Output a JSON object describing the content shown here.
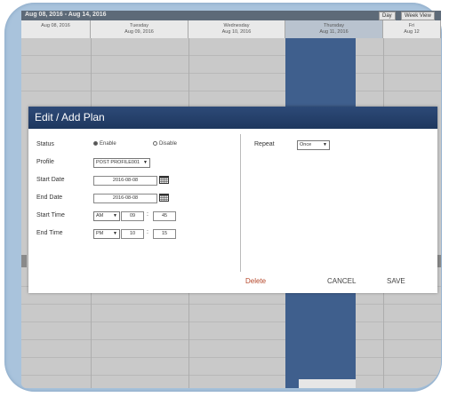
{
  "calendar": {
    "range": "Aug 08, 2016 - Aug 14, 2016",
    "buttons": [
      "Day",
      "Week View"
    ],
    "days": [
      {
        "name": "",
        "date": "Aug 08, 2016"
      },
      {
        "name": "Tuesday",
        "date": "Aug 09, 2016"
      },
      {
        "name": "Wednesday",
        "date": "Aug 10, 2016"
      },
      {
        "name": "Thursday",
        "date": "Aug 11, 2016"
      },
      {
        "name": "Fri",
        "date": "Aug 12"
      }
    ]
  },
  "dialog": {
    "title": "Edit / Add Plan",
    "status_label": "Status",
    "enable_label": "Enable",
    "disable_label": "Disable",
    "profile_label": "Profile",
    "profile_value": "POST PROFILE001",
    "start_date_label": "Start Date",
    "start_date_value": "2016-08-08",
    "end_date_label": "End Date",
    "end_date_value": "2016-08-08",
    "start_time_label": "Start Time",
    "start_time_ampm": "AM",
    "start_time_hour": "09",
    "start_time_min": "45",
    "end_time_label": "End Time",
    "end_time_ampm": "PM",
    "end_time_hour": "10",
    "end_time_min": "15",
    "repeat_label": "Repeat",
    "repeat_value": "Once",
    "delete_label": "Delete",
    "cancel_label": "CANCEL",
    "save_label": "SAVE"
  },
  "colors": {
    "title_bar": "#1e375e",
    "selected_column": "#3f5f8d",
    "delete": "#b5472a",
    "frame": "#a9c3dc"
  }
}
